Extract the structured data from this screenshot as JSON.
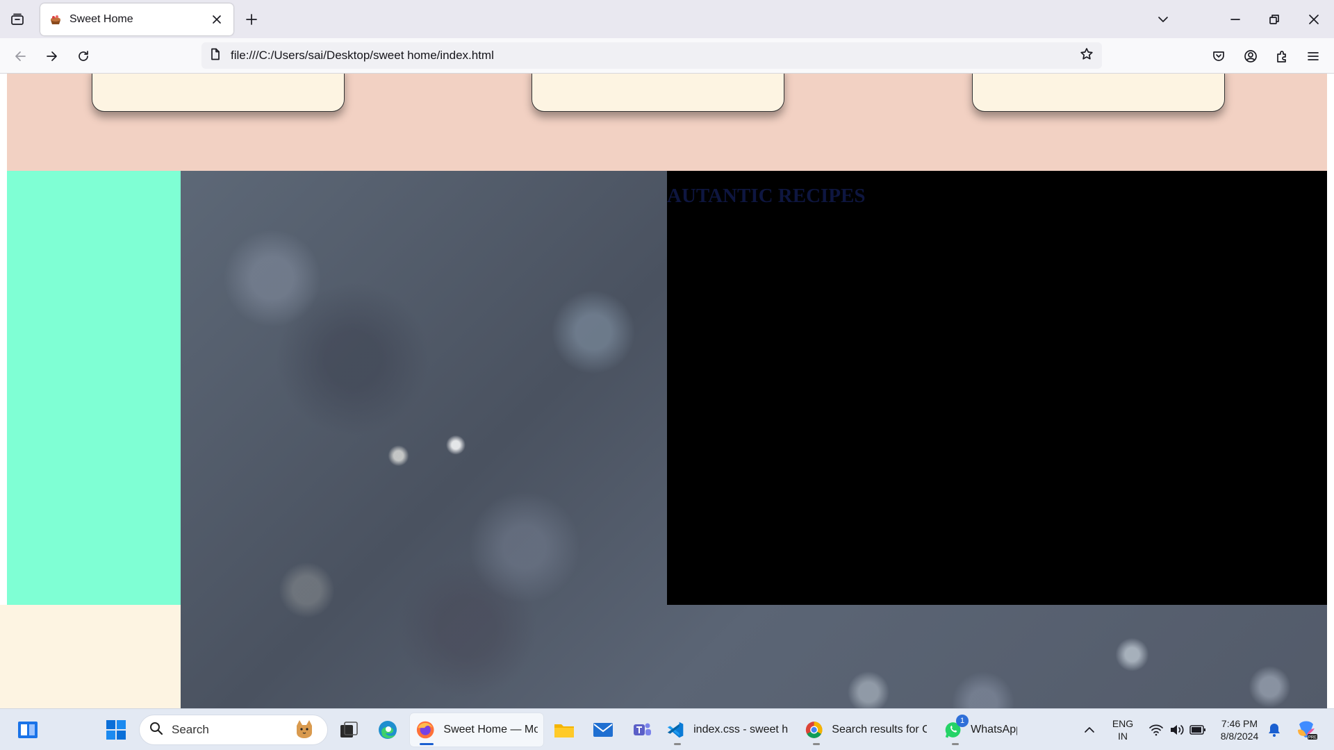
{
  "browser": {
    "tab_title": "Sweet Home",
    "url": "file:///C:/Users/sai/Desktop/sweet home/index.html"
  },
  "page": {
    "heading": "AUTANTIC RECIPES",
    "colors": {
      "peach": "#f2d1c3",
      "card": "#fdf4e2",
      "aqua": "#7fffd4",
      "panel": "#000000",
      "heading": "#0e1640"
    }
  },
  "taskbar": {
    "search_placeholder": "Search",
    "apps": [
      {
        "name": "firefox-icon",
        "label": "Sweet Home — Mo:"
      },
      {
        "name": "vscode-icon",
        "label": "index.css - sweet ho"
      },
      {
        "name": "chrome-icon",
        "label": "Search results for Co"
      },
      {
        "name": "whatsapp-icon",
        "label": "WhatsApp",
        "badge": "1"
      }
    ],
    "language_line1": "ENG",
    "language_line2": "IN",
    "time": "7:46 PM",
    "date": "8/8/2024"
  }
}
